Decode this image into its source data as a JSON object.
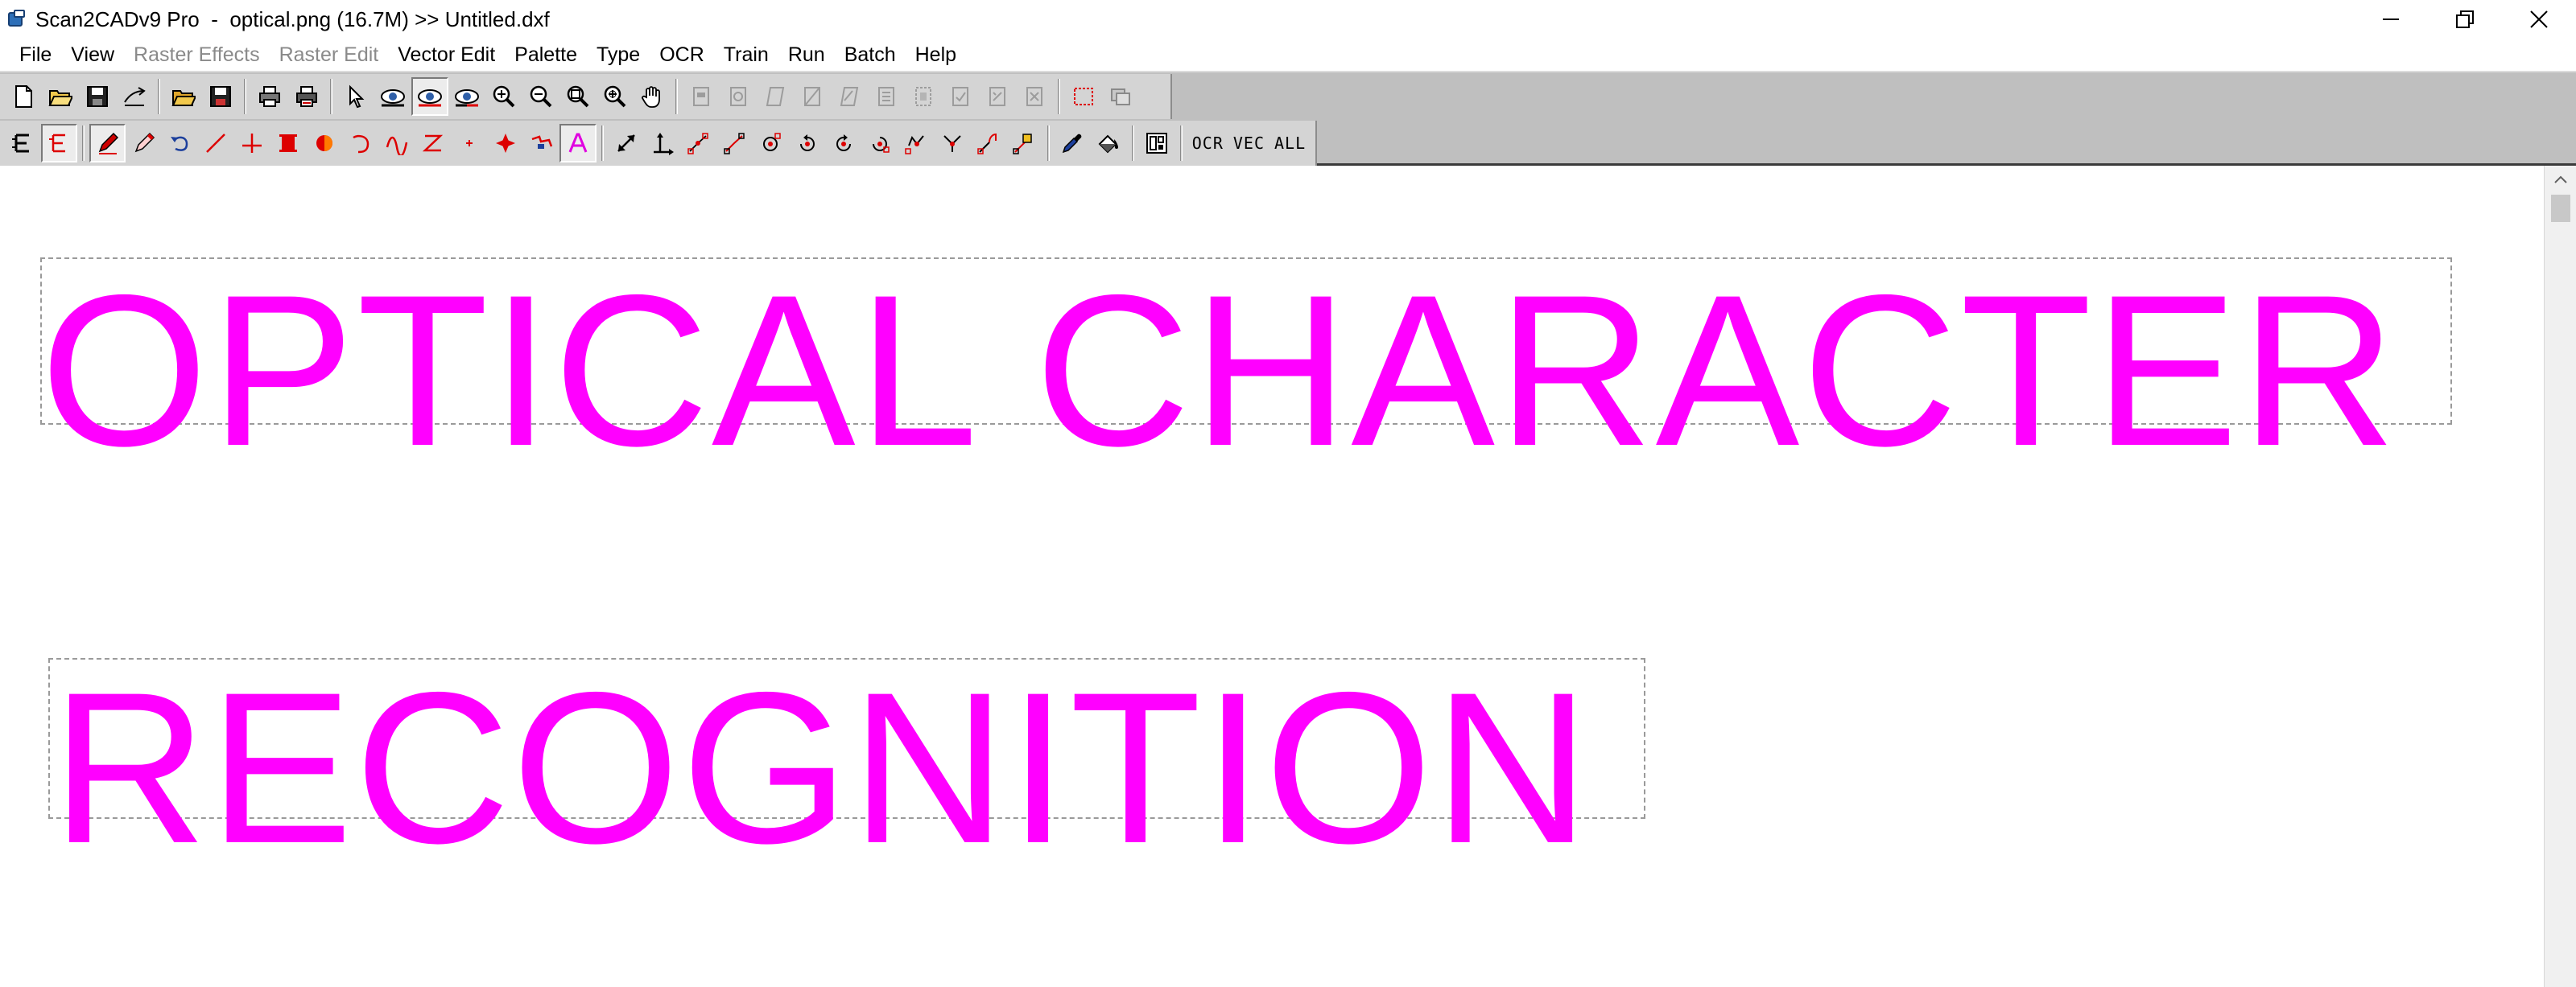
{
  "window": {
    "title": "Scan2CADv9 Pro  -  optical.png (16.7M) >> Untitled.dxf"
  },
  "menu": {
    "items": [
      {
        "label": "File",
        "enabled": true
      },
      {
        "label": "View",
        "enabled": true
      },
      {
        "label": "Raster Effects",
        "enabled": false
      },
      {
        "label": "Raster Edit",
        "enabled": false
      },
      {
        "label": "Vector Edit",
        "enabled": true
      },
      {
        "label": "Palette",
        "enabled": true
      },
      {
        "label": "Type",
        "enabled": true
      },
      {
        "label": "OCR",
        "enabled": true
      },
      {
        "label": "Train",
        "enabled": true
      },
      {
        "label": "Run",
        "enabled": true
      },
      {
        "label": "Batch",
        "enabled": true
      },
      {
        "label": "Help",
        "enabled": true
      }
    ]
  },
  "toolbar": {
    "ocr_label": "OCR",
    "vec_label": "VEC",
    "all_label": "ALL"
  },
  "canvas": {
    "ocr_line_1": "OPTICAL CHARACTER",
    "ocr_line_2": "RECOGNITION",
    "text_color": "#ff00ff"
  }
}
